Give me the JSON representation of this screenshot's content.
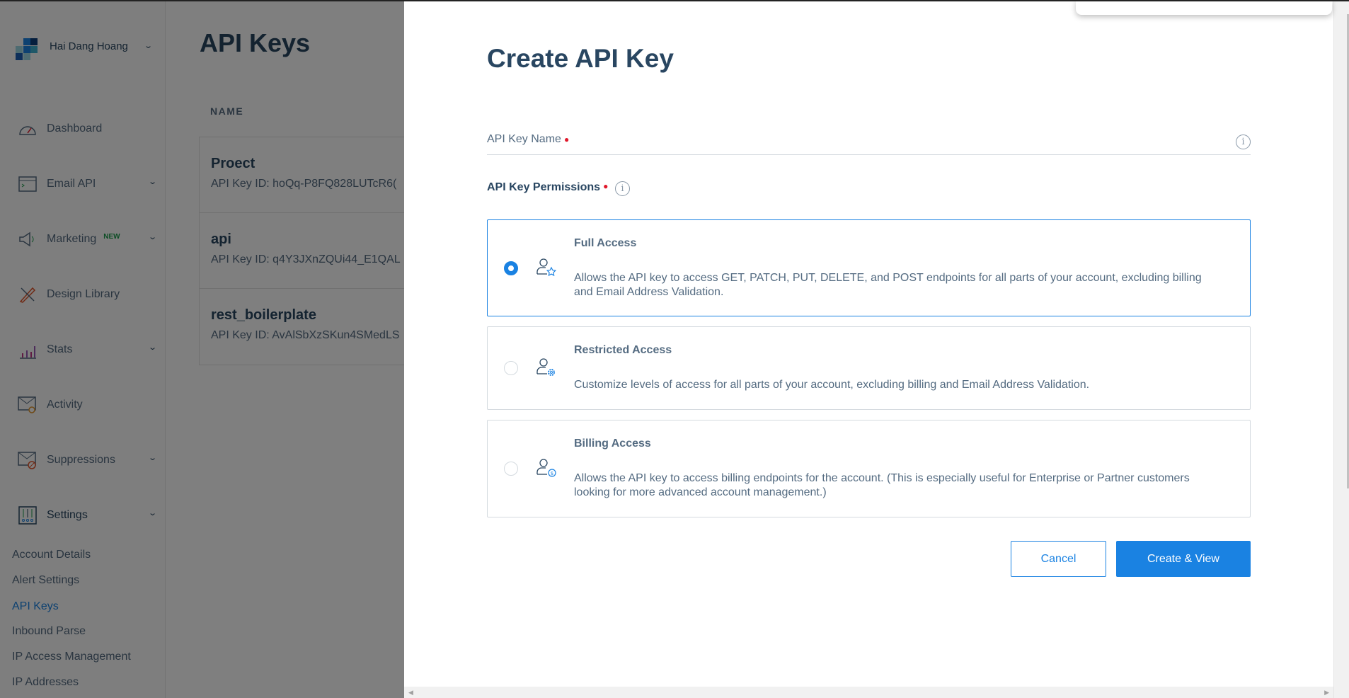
{
  "account": {
    "name": "Hai Dang Hoang"
  },
  "sidebar": {
    "items": [
      {
        "label": "Dashboard",
        "icon": "dashboard-icon"
      },
      {
        "label": "Email API",
        "icon": "terminal-icon",
        "chevron": true
      },
      {
        "label": "Marketing",
        "icon": "megaphone-icon",
        "badge": "NEW",
        "chevron": true
      },
      {
        "label": "Design Library",
        "icon": "design-icon"
      },
      {
        "label": "Stats",
        "icon": "stats-icon",
        "chevron": true
      },
      {
        "label": "Activity",
        "icon": "mail-search-icon"
      },
      {
        "label": "Suppressions",
        "icon": "mail-block-icon",
        "chevron": true
      },
      {
        "label": "Settings",
        "icon": "sliders-icon",
        "chevron": true
      }
    ],
    "sub_items": [
      "Account Details",
      "Alert Settings",
      "API Keys",
      "Inbound Parse",
      "IP Access Management",
      "IP Addresses"
    ],
    "active_sub": "API Keys"
  },
  "page": {
    "title": "API Keys",
    "column": "NAME",
    "rows": [
      {
        "name": "Proect",
        "id": "API Key ID: hoQq-P8FQ828LUTcR6("
      },
      {
        "name": "api",
        "id": "API Key ID: q4Y3JXnZQUi44_E1QAL"
      },
      {
        "name": "rest_boilerplate",
        "id": "API Key ID: AvAlSbXzSKun4SMedLS"
      }
    ]
  },
  "modal": {
    "title": "Create API Key",
    "name_label": "API Key Name",
    "name_value": "",
    "permissions_label": "API Key Permissions",
    "options": [
      {
        "title": "Full Access",
        "desc": "Allows the API key to access GET, PATCH, PUT, DELETE, and POST endpoints for all parts of your account, excluding billing and Email Address Validation.",
        "selected": true
      },
      {
        "title": "Restricted Access",
        "desc": "Customize levels of access for all parts of your account, excluding billing and Email Address Validation.",
        "selected": false
      },
      {
        "title": "Billing Access",
        "desc": "Allows the API key to access billing endpoints for the account. (This is especially useful for Enterprise or Partner customers looking for more advanced account management.)",
        "selected": false
      }
    ],
    "cancel": "Cancel",
    "create": "Create & View"
  },
  "colors": {
    "accent": "#1a82e2",
    "text": "#294661",
    "muted": "#546b81"
  }
}
